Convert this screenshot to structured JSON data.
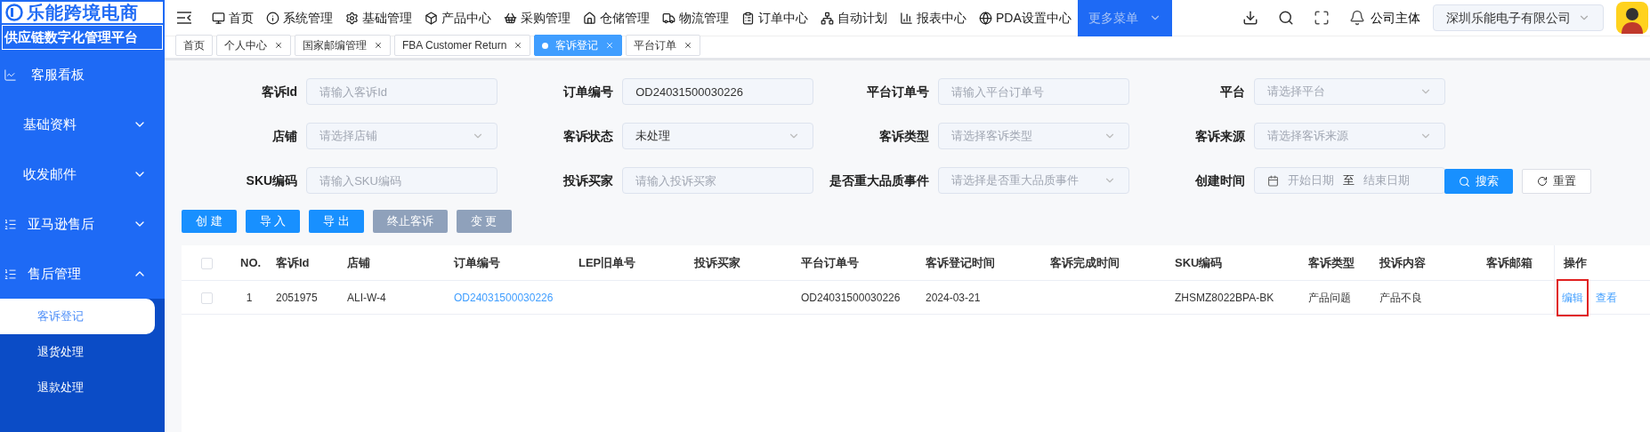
{
  "logo": {
    "title": "乐能跨境电商",
    "subtitle": "供应链数字化管理平台"
  },
  "top_menu": [
    {
      "label": "首页",
      "selected": false
    },
    {
      "label": "系统管理",
      "selected": false
    },
    {
      "label": "基础管理",
      "selected": false
    },
    {
      "label": "产品中心",
      "selected": false
    },
    {
      "label": "采购管理",
      "selected": false
    },
    {
      "label": "仓储管理",
      "selected": false
    },
    {
      "label": "物流管理",
      "selected": false
    },
    {
      "label": "订单中心",
      "selected": false
    },
    {
      "label": "自动计划",
      "selected": false
    },
    {
      "label": "报表中心",
      "selected": false
    },
    {
      "label": "PDA设置中心",
      "selected": false
    },
    {
      "label": "更多菜单",
      "selected": true
    }
  ],
  "header": {
    "company_label": "公司主体",
    "company_value": "深圳乐能电子有限公司"
  },
  "tabs": [
    {
      "label": "首页",
      "selected": false
    },
    {
      "label": "个人中心",
      "selected": false
    },
    {
      "label": "国家邮编管理",
      "selected": false
    },
    {
      "label": "FBA Customer Return",
      "selected": false
    },
    {
      "label": "客诉登记",
      "selected": true
    },
    {
      "label": "平台订单",
      "selected": false
    }
  ],
  "sidebar": {
    "items": [
      {
        "label": "客服看板"
      },
      {
        "label": "基础资料",
        "expanded": false
      },
      {
        "label": "收发邮件",
        "expanded": false
      },
      {
        "label": "亚马逊售后",
        "expanded": false
      },
      {
        "label": "售后管理",
        "expanded": true,
        "children": [
          {
            "label": "客诉登记",
            "selected": true
          },
          {
            "label": "退货处理",
            "selected": false
          },
          {
            "label": "退款处理",
            "selected": false
          }
        ]
      }
    ]
  },
  "filters": [
    {
      "label": "客诉Id",
      "kind": "input",
      "placeholder": "请输入客诉Id"
    },
    {
      "label": "订单编号",
      "kind": "input",
      "value": "OD24031500030226"
    },
    {
      "label": "平台订单号",
      "kind": "input",
      "placeholder": "请输入平台订单号"
    },
    {
      "label": "平台",
      "kind": "select",
      "placeholder": "请选择平台"
    },
    {
      "label": "店铺",
      "kind": "select",
      "placeholder": "请选择店铺"
    },
    {
      "label": "客诉状态",
      "kind": "select",
      "value": "未处理"
    },
    {
      "label": "客诉类型",
      "kind": "select",
      "placeholder": "请选择客诉类型"
    },
    {
      "label": "客诉来源",
      "kind": "select",
      "placeholder": "请选择客诉来源"
    },
    {
      "label": "SKU编码",
      "kind": "input",
      "placeholder": "请输入SKU编码"
    },
    {
      "label": "投诉买家",
      "kind": "input",
      "placeholder": "请输入投诉买家"
    },
    {
      "label": "是否重大品质事件",
      "kind": "select",
      "placeholder": "请选择是否重大品质事件"
    },
    {
      "label": "创建时间",
      "kind": "daterange",
      "start_placeholder": "开始日期",
      "separator": "至",
      "end_placeholder": "结束日期"
    }
  ],
  "search_buttons": [
    {
      "label": "搜索",
      "kind": "primary"
    },
    {
      "label": "重置",
      "kind": "reset"
    }
  ],
  "actions": [
    {
      "label": "创 建",
      "disabled": false
    },
    {
      "label": "导 入",
      "disabled": false
    },
    {
      "label": "导 出",
      "disabled": false
    },
    {
      "label": "终止客诉",
      "disabled": true
    },
    {
      "label": "变 更",
      "disabled": true
    }
  ],
  "table": {
    "select_all_checked": false,
    "columns": [
      "NO.",
      "客诉Id",
      "店铺",
      "订单编号",
      "LEP旧单号",
      "投诉买家",
      "平台订单号",
      "客诉登记时间",
      "客诉完成时间",
      "SKU编码",
      "客诉类型",
      "投诉内容",
      "客诉邮箱",
      "操作"
    ],
    "rows": [
      {
        "checked": false,
        "cells": [
          "1",
          "2051975",
          "ALI-W-4",
          "OD24031500030226",
          "",
          "",
          "OD24031500030226",
          "2024-03-21",
          "",
          "ZHSMZ8022BPA-BK",
          "产品问题",
          "产品不良",
          ""
        ],
        "operations": [
          {
            "label": "编辑",
            "highlighted": true
          },
          {
            "label": "查看",
            "highlighted": false
          }
        ]
      }
    ]
  }
}
